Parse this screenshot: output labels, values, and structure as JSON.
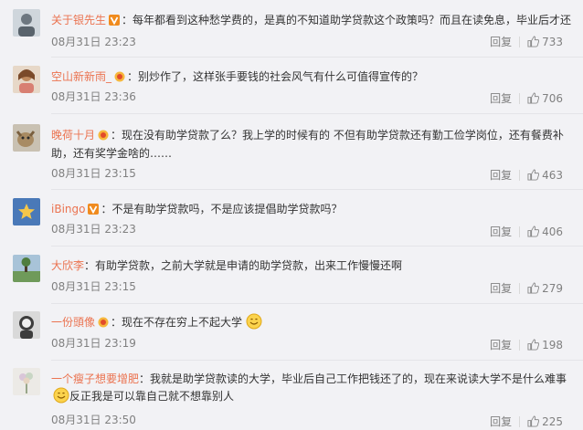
{
  "colon": "：",
  "reply_label": "回复",
  "comments": [
    {
      "user": "关于银先生",
      "badge": "vip",
      "text": "每年都看到这种愁学费的，是真的不知道助学贷款这个政策吗？而且在读免息，毕业后才还",
      "time": "08月31日 23:23",
      "likes": "733"
    },
    {
      "user": "空山新新雨_",
      "badge": "gold",
      "text": "别炒作了，这样张手要钱的社会风气有什么可值得宣传的？",
      "time": "08月31日 23:36",
      "likes": "706"
    },
    {
      "user": "晚荷十月",
      "badge": "gold",
      "text": "现在没有助学贷款了么？我上学的时候有的 不但有助学贷款还有勤工俭学岗位，还有餐费补助，还有奖学金啥的……",
      "time": "08月31日 23:15",
      "likes": "463"
    },
    {
      "user": "iBingo",
      "badge": "vip",
      "text": "不是有助学贷款吗，不是应该提倡助学贷款吗？",
      "time": "08月31日 23:23",
      "likes": "406"
    },
    {
      "user": "大欣李",
      "badge": "",
      "text": "有助学贷款，之前大学就是申请的助学贷款，出来工作慢慢还啊",
      "time": "08月31日 23:15",
      "likes": "279"
    },
    {
      "user": "一份頭像",
      "badge": "gold",
      "text": "现在不存在穷上不起大学",
      "time": "08月31日 23:19",
      "likes": "198"
    },
    {
      "user": "一个瘦子想要增肥",
      "badge": "",
      "text": "我就是助学贷款读的大学，毕业后自己工作把钱还了的，现在来说读大学不是什么难事",
      "text2": "反正我是可以靠自己就不想靠别人",
      "time": "08月31日 23:50",
      "likes": "225"
    }
  ]
}
